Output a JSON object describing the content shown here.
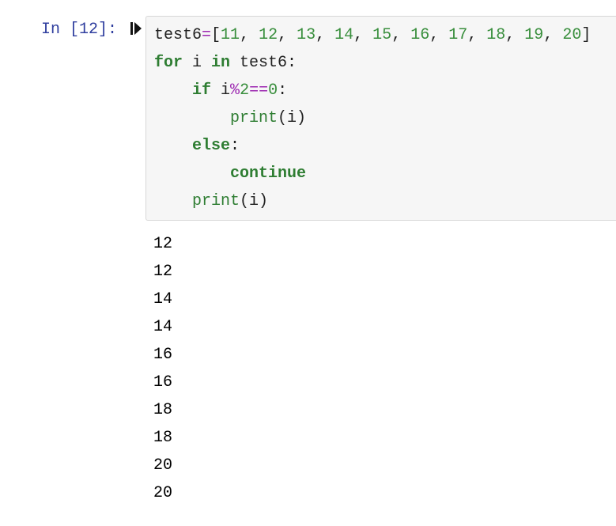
{
  "cell": {
    "prompt_prefix": "In ",
    "exec_count": "[12]",
    "prompt_suffix": ":",
    "run_icon": "run-cell-icon",
    "code": {
      "line1": {
        "p1": "test6",
        "op1": "=",
        "open": "[",
        "n1": "11",
        "c": ", ",
        "n2": "12",
        "n3": "13",
        "n4": "14",
        "n5": "15",
        "n6": "16",
        "n7": "17",
        "n8": "18",
        "n9": "19",
        "n10": "20",
        "close": "]"
      },
      "line2": {
        "kw1": "for",
        "s1": " i ",
        "kw2": "in",
        "s2": " test6:"
      },
      "line3": {
        "indent": "    ",
        "kw": "if",
        "s1": " i",
        "op1": "%",
        "n1": "2",
        "op2": "==",
        "n2": "0",
        "s2": ":"
      },
      "line4": {
        "indent": "        ",
        "fn": "print",
        "arg": "(i)"
      },
      "line5": {
        "indent": "    ",
        "kw": "else",
        "s": ":"
      },
      "line6": {
        "indent": "        ",
        "kw": "continue"
      },
      "line7": {
        "indent": "    ",
        "fn": "print",
        "arg": "(i)"
      }
    }
  },
  "output": "12\n12\n14\n14\n16\n16\n18\n18\n20\n20"
}
